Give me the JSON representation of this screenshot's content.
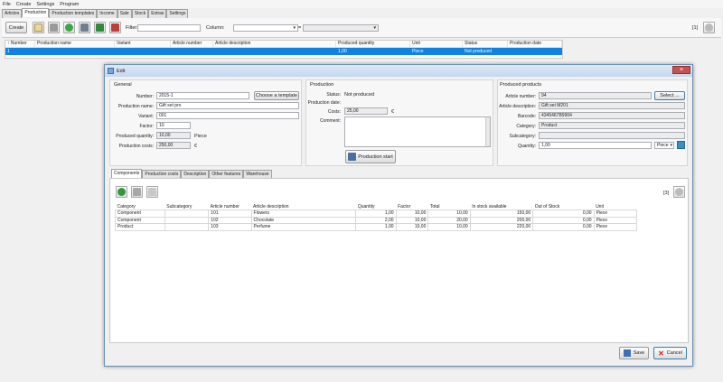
{
  "menu": [
    "File",
    "Create",
    "Settings",
    "Program"
  ],
  "tabs": [
    "Articles",
    "Production",
    "Production templates",
    "Income",
    "Sale",
    "Stock",
    "Extras",
    "Settings"
  ],
  "toolbar": {
    "create_label": "Create",
    "filter_label": "Filter:",
    "filter_value": "",
    "column_label": "Column:",
    "equals": "=",
    "count": "[1]"
  },
  "grid": {
    "columns": [
      "↑ Number",
      "Production name",
      "Variant",
      "Article number",
      "Article description",
      "Produced quantity",
      "Unit",
      "Status",
      "Production date"
    ],
    "rows": [
      [
        "1",
        "",
        "",
        "",
        "",
        "1,00",
        "Piece",
        "Not produced",
        ""
      ]
    ]
  },
  "dialog": {
    "title": "Edit",
    "general": {
      "heading": "General",
      "number_label": "Number:",
      "number": "2015-1",
      "choose_template": "Choose a template",
      "name_label": "Production name:",
      "name": "Gift set pro",
      "variant_label": "Variant:",
      "variant": "001",
      "factor_label": "Factor:",
      "factor": "10",
      "qty_label": "Produced quantity:",
      "qty": "10,00",
      "qty_unit": "Piece",
      "costs_label": "Production costs:",
      "costs": "250,00",
      "currency": "€"
    },
    "production": {
      "heading": "Production",
      "status_label": "Status:",
      "status": "Not produced",
      "date_label": "Production date:",
      "costs_label": "Costs:",
      "costs": "25,00",
      "currency": "€",
      "comment_label": "Comment:",
      "start_label": "Production start"
    },
    "produced": {
      "heading": "Produced products",
      "article_number_label": "Article number:",
      "article_number": "94",
      "select_label": "Select ...",
      "article_desc_label": "Article description:",
      "article_desc": "Gift set M201",
      "barcode_label": "Barcode:",
      "barcode": "4345467B9904",
      "category_label": "Category:",
      "category": "Product",
      "subcategory_label": "Subcategory:",
      "subcategory": "",
      "quantity_label": "Quantity:",
      "quantity": "1,00",
      "unit": "Piece"
    },
    "inner_tabs": [
      "Components",
      "Production costs",
      "Description",
      "Other features",
      "Warehouse"
    ],
    "components": {
      "count": "[3]",
      "columns": [
        "Category",
        "Subcategory",
        "Article number",
        "Article description",
        "Quantity",
        "Factor",
        "Total",
        "In stock available",
        "Out of Stock",
        "Unit"
      ],
      "rows": [
        [
          "Component",
          "",
          "101",
          "Flowers",
          "1,00",
          "10,00",
          "10,00",
          "150,00",
          "0,00",
          "Piece"
        ],
        [
          "Component",
          "",
          "102",
          "Chocolate",
          "2,00",
          "10,00",
          "20,00",
          "200,00",
          "0,00",
          "Piece"
        ],
        [
          "Product",
          "",
          "103",
          "Perfume",
          "1,00",
          "10,00",
          "10,00",
          "220,00",
          "0,00",
          "Piece"
        ]
      ]
    },
    "save_label": "Save",
    "cancel_label": "Cancel"
  },
  "colors": {
    "selection": "#0f82e3",
    "accent_green": "#2f9a3a",
    "close_red": "#c75050"
  }
}
